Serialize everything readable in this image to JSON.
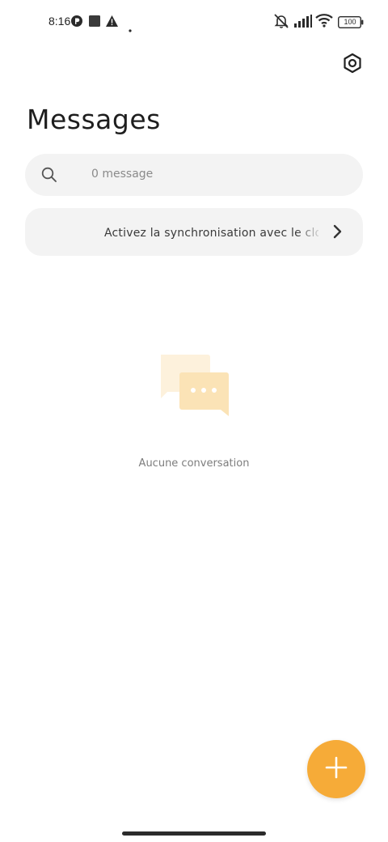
{
  "status_bar": {
    "time": "8:16",
    "battery": "100",
    "icons": [
      "p-icon",
      "square-icon",
      "warning-icon",
      "dot-icon",
      "mute-icon",
      "signal-icon",
      "wifi-icon",
      "battery-icon"
    ]
  },
  "header": {
    "title": "Messages",
    "settings_icon": "settings-hexagon-icon"
  },
  "search": {
    "placeholder": "0 message"
  },
  "sync_banner": {
    "text": "Activez la synchronisation avec le cloud"
  },
  "empty_state": {
    "text": "Aucune conversation"
  },
  "fab": {
    "icon": "plus-icon"
  },
  "colors": {
    "accent": "#f6ab38",
    "surface": "#f3f3f3",
    "illustration_light": "#fdf1dc",
    "illustration_mid": "#fbe3b6"
  }
}
